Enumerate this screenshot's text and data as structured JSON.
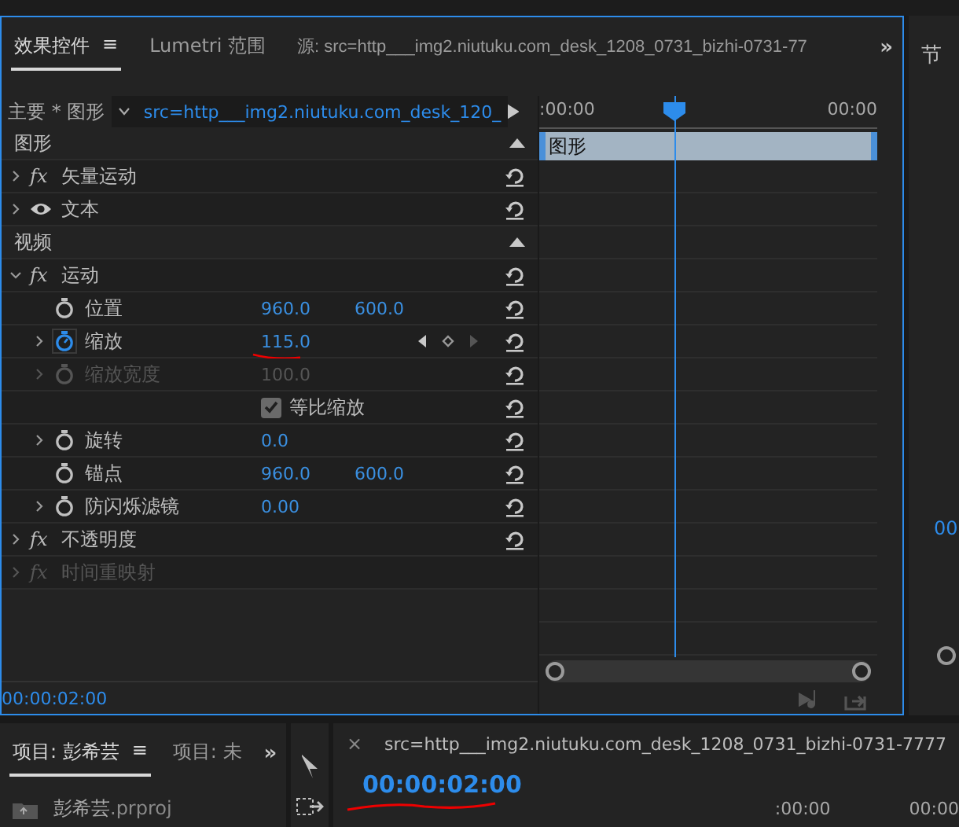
{
  "top_panel": {
    "tabs": [
      {
        "label": "效果控件",
        "menu": "≡",
        "selected": true
      },
      {
        "label": "Lumetri 范围",
        "selected": false
      },
      {
        "label": "源: src=http___img2.niutuku.com_desk_1208_0731_bizhi-0731-77",
        "selected": false
      }
    ],
    "overflow": "»",
    "master_label": "主要 * 图形",
    "clip_selector": "src=http___img2.niutuku.com_desk_120_",
    "sections": [
      {
        "title": "图形",
        "expanded": true,
        "effects": [
          {
            "kind": "fx",
            "symbol": "fx",
            "label": "矢量运动",
            "expanded": false,
            "disabled": false
          },
          {
            "kind": "eye",
            "label": "文本",
            "expanded": false,
            "disabled": false
          }
        ]
      },
      {
        "title": "视频",
        "expanded": true,
        "effects": [
          {
            "kind": "fx",
            "symbol": "fx",
            "label": "运动",
            "expanded": true,
            "disabled": false,
            "children": [
              {
                "kind": "property",
                "label": "位置",
                "values": [
                  "960.0",
                  "600.0"
                ],
                "expandable": false,
                "animated": false,
                "disabled": false,
                "underlined": false
              },
              {
                "kind": "property",
                "label": "缩放",
                "values": [
                  "115.0"
                ],
                "expandable": true,
                "animated": true,
                "disabled": false,
                "underlined": true
              },
              {
                "kind": "property",
                "label": "缩放宽度",
                "values": [
                  "100.0"
                ],
                "expandable": true,
                "animated": false,
                "disabled": true,
                "underlined": false
              },
              {
                "kind": "checkbox",
                "label": "等比缩放",
                "checked": true
              },
              {
                "kind": "property",
                "label": "旋转",
                "values": [
                  "0.0"
                ],
                "expandable": true,
                "animated": false,
                "disabled": false,
                "underlined": false
              },
              {
                "kind": "property",
                "label": "锚点",
                "values": [
                  "960.0",
                  "600.0"
                ],
                "expandable": false,
                "animated": false,
                "disabled": false,
                "underlined": false
              },
              {
                "kind": "property",
                "label": "防闪烁滤镜",
                "values": [
                  "0.00"
                ],
                "expandable": true,
                "animated": false,
                "disabled": false,
                "underlined": false
              }
            ]
          },
          {
            "kind": "fx",
            "symbol": "fx",
            "label": "不透明度",
            "expanded": false,
            "disabled": false
          },
          {
            "kind": "fx",
            "symbol": "fx",
            "label": "时间重映射",
            "expanded": false,
            "disabled": true
          }
        ]
      }
    ],
    "timeline": {
      "start": ":00:00",
      "end": "00:00",
      "clip_label": "图形"
    },
    "current_time": "00:00:02:00"
  },
  "program_panel": {
    "tab": "节",
    "timecode": "00"
  },
  "project_panel": {
    "tabs": [
      {
        "label": "项目: 彭希芸",
        "menu": "≡",
        "selected": true
      },
      {
        "label": "项目: 未",
        "selected": false
      }
    ],
    "overflow": "»",
    "file_name": "彭希芸",
    "file_ext": ".prproj"
  },
  "sequence_panel": {
    "close": "×",
    "title": "src=http___img2.niutuku.com_desk_1208_0731_bizhi-0731-7777",
    "timecode": "00:00:02:00",
    "timecode_underlined": true,
    "ruler": [
      ":00:00",
      "00:00"
    ]
  }
}
